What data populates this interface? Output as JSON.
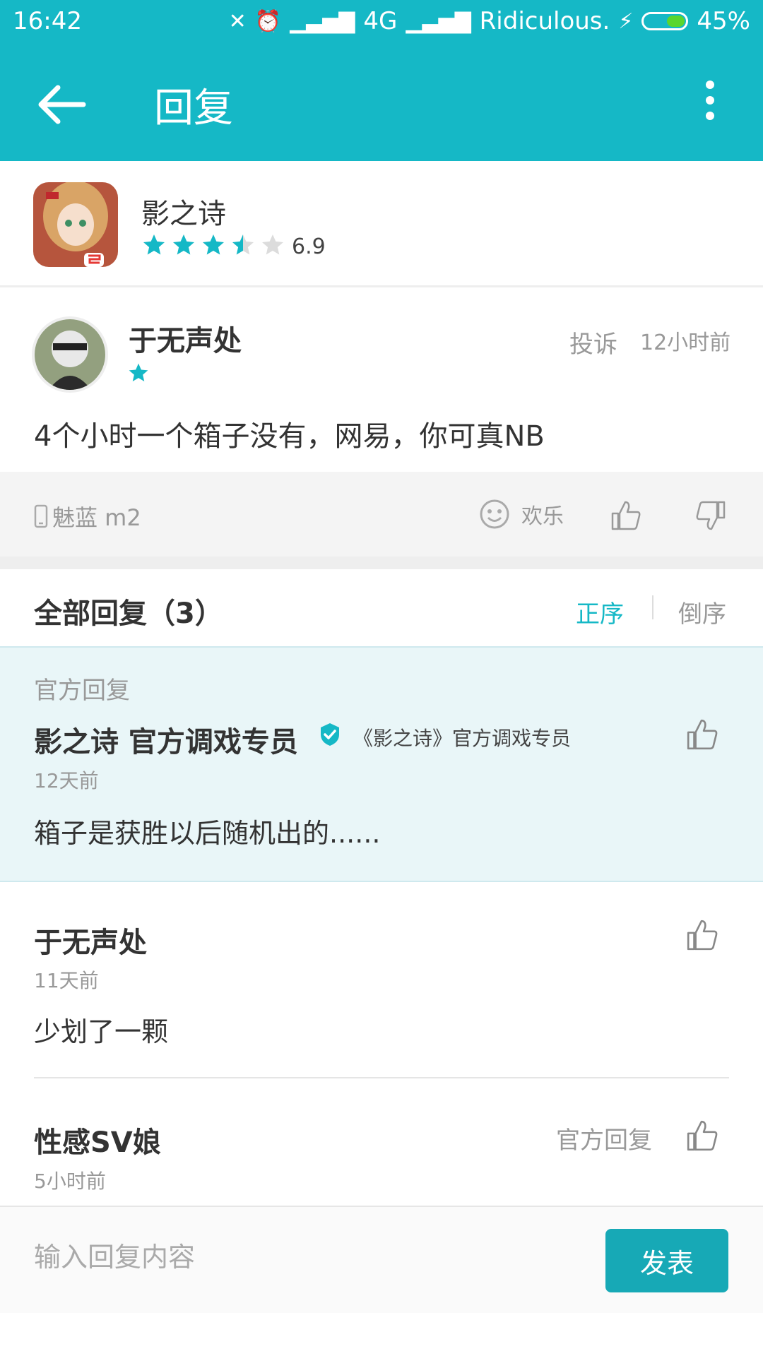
{
  "status_bar": {
    "time": "16:42",
    "network": "4G",
    "carrier": "Ridiculous.",
    "battery": "45%"
  },
  "header": {
    "title": "回复",
    "color": "#15b8c6"
  },
  "app": {
    "name": "影之诗",
    "rating_value": "6.9",
    "stars": 3.5
  },
  "comment": {
    "user": "于无声处",
    "report": "投诉",
    "time": "12小时前",
    "user_stars": 1,
    "text": "4个小时一个箱子没有，网易，你可真NB",
    "device": "魅蓝 m2",
    "mood": "欢乐"
  },
  "replies": {
    "title": "全部回复（3）",
    "sort_asc": "正序",
    "sort_desc": "倒序",
    "items": [
      {
        "label": "官方回复",
        "name": "影之诗 官方调戏专员",
        "role": "《影之诗》官方调戏专员",
        "time": "12天前",
        "text": "箱子是获胜以后随机出的......"
      },
      {
        "name": "于无声处",
        "time": "11天前",
        "text": "少划了一颗"
      },
      {
        "name": "性感SV娘",
        "tag": "官方回复",
        "time": "5小时前"
      }
    ]
  },
  "input": {
    "placeholder": "输入回复内容",
    "submit": "发表"
  },
  "icons": [
    "back-arrow-icon",
    "more-icon",
    "star-icon",
    "phone-icon",
    "smile-icon",
    "thumb-up-icon",
    "thumb-down-icon",
    "verified-icon"
  ]
}
